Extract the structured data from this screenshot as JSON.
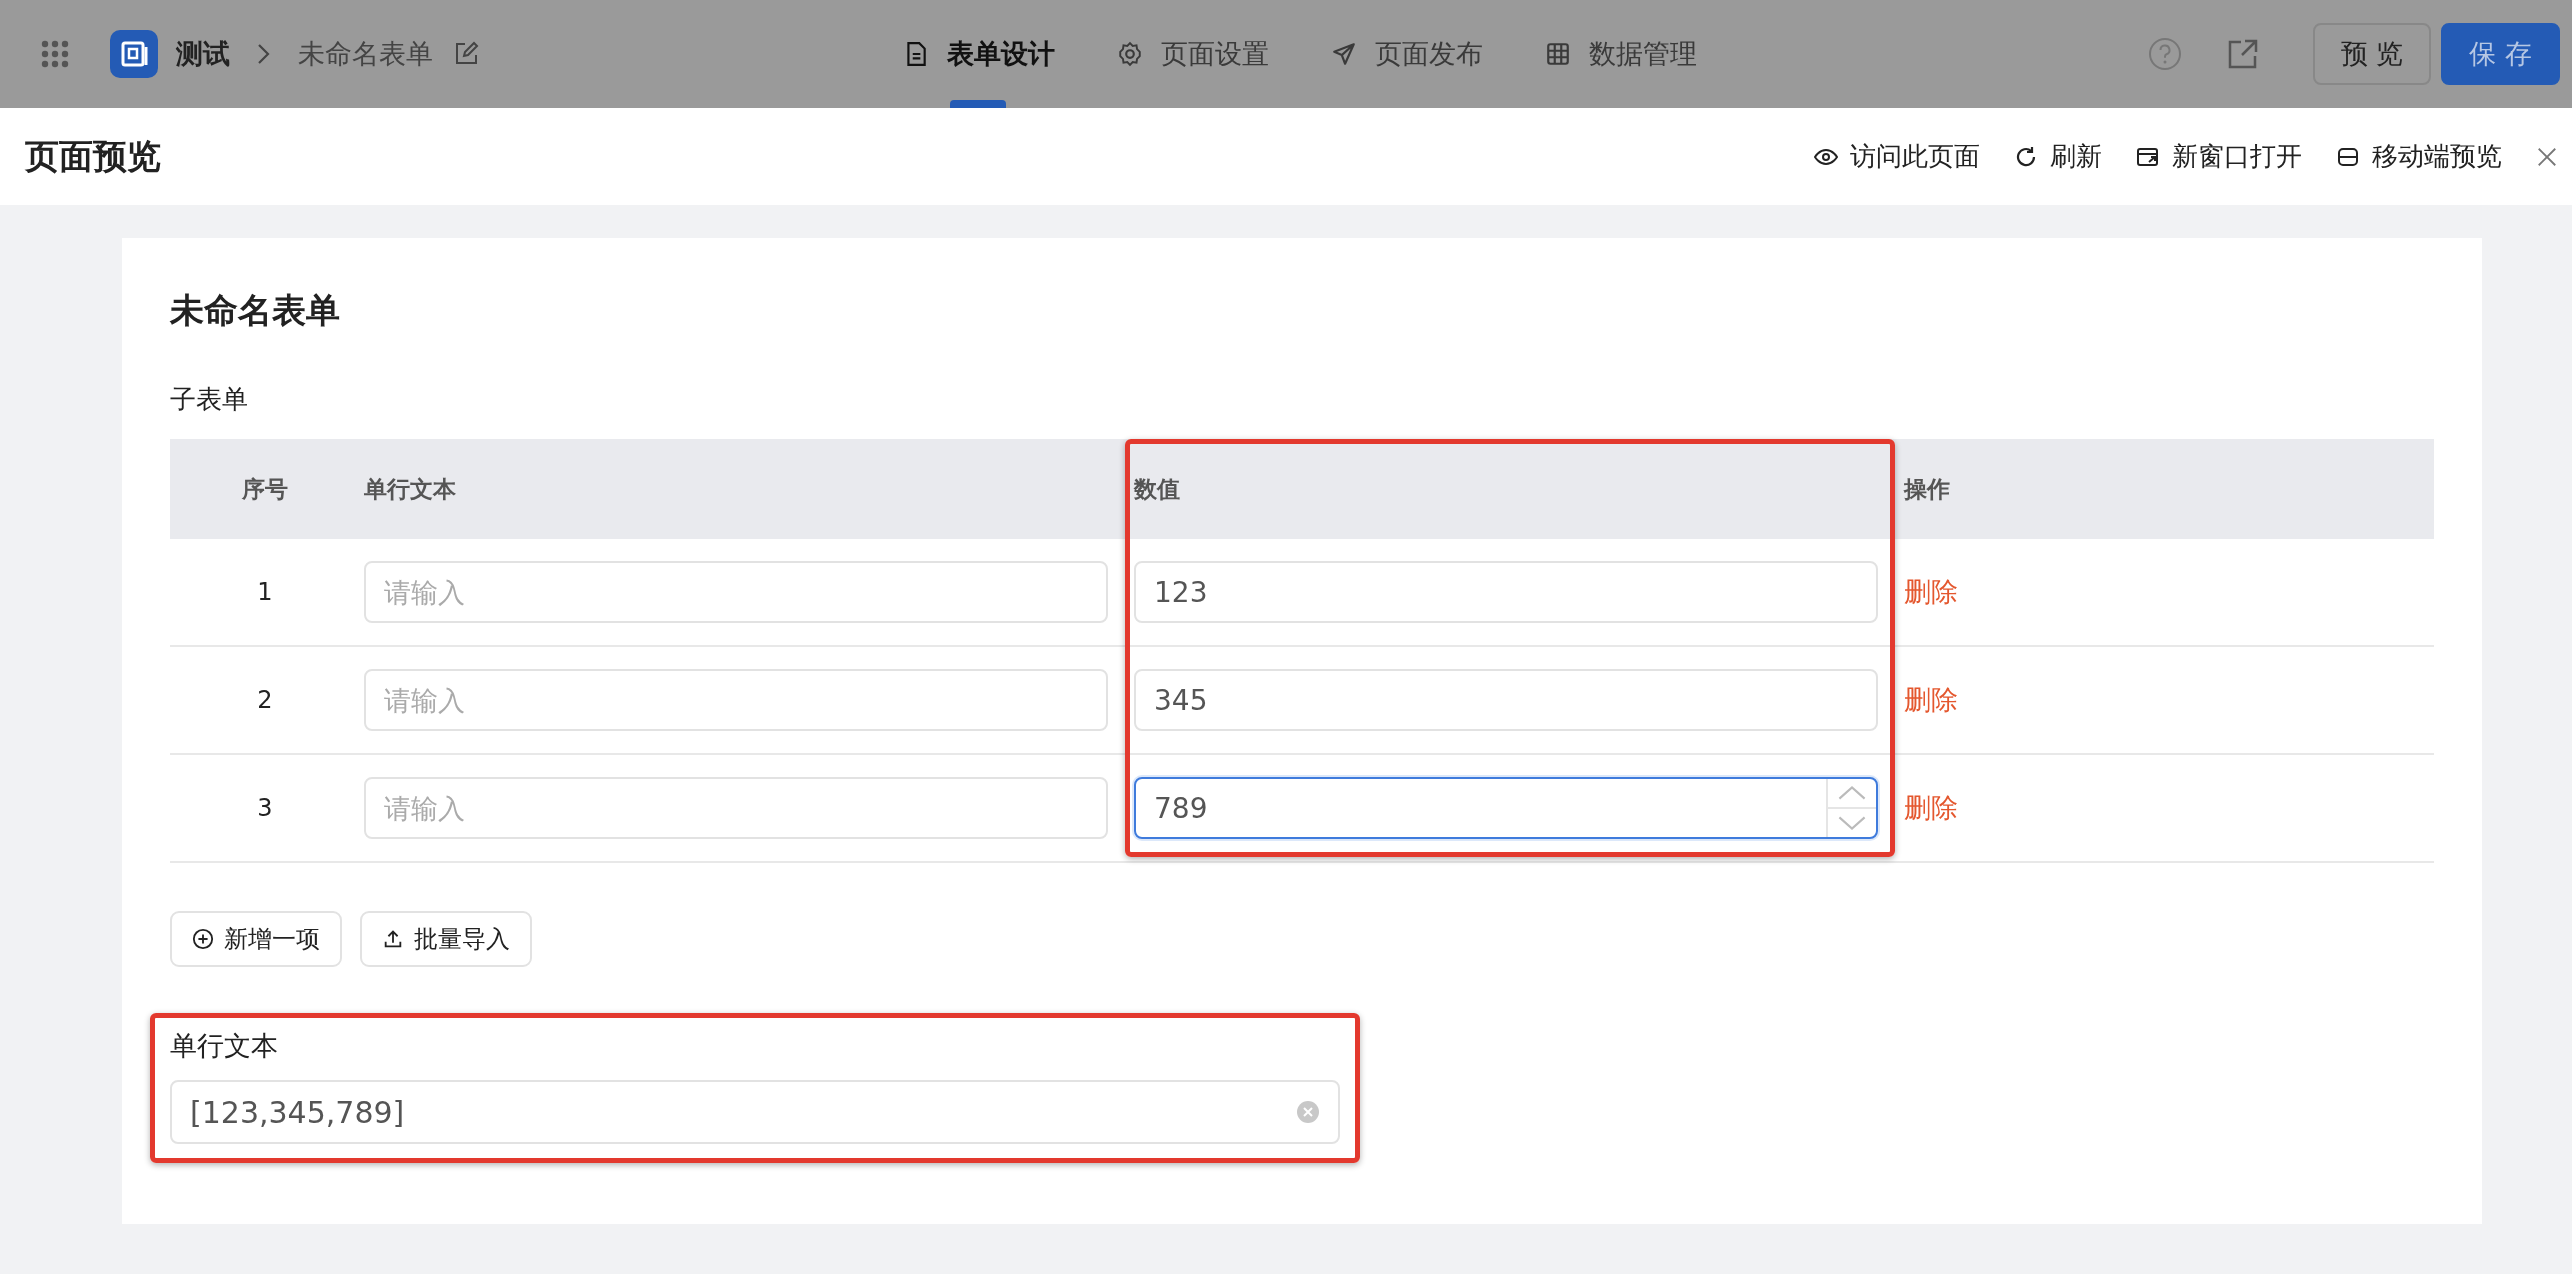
{
  "top_bar": {
    "app_name": "测试",
    "form_name": "未命名表单",
    "tabs": [
      {
        "label": "表单设计",
        "kind": "doc",
        "selected": true
      },
      {
        "label": "页面设置",
        "kind": "gear",
        "selected": false
      },
      {
        "label": "页面发布",
        "kind": "send",
        "selected": false
      },
      {
        "label": "数据管理",
        "kind": "grid",
        "selected": false
      }
    ],
    "buttons": [
      {
        "label": "预 览",
        "kind": "default"
      },
      {
        "label": "保 存",
        "kind": "primary"
      }
    ]
  },
  "preview": {
    "title": "页面预览",
    "actions": [
      {
        "label": "访问此页面",
        "kind": "eye"
      },
      {
        "label": "刷新",
        "kind": "refresh"
      },
      {
        "label": "新窗口打开",
        "kind": "window"
      },
      {
        "label": "移动端预览",
        "kind": "mobile"
      }
    ]
  },
  "form": {
    "title": "未命名表单",
    "subform": {
      "label": "子表单",
      "columns": [
        "序号",
        "单行文本",
        "数值",
        "操作"
      ],
      "rows": [
        {
          "index": "1",
          "text_placeholder": "请输入",
          "number": "123",
          "focused": false,
          "action": "删除"
        },
        {
          "index": "2",
          "text_placeholder": "请输入",
          "number": "345",
          "focused": false,
          "action": "删除"
        },
        {
          "index": "3",
          "text_placeholder": "请输入",
          "number": "789",
          "focused": true,
          "action": "删除"
        }
      ]
    },
    "buttons": [
      {
        "label": "新增一项",
        "kind": "add"
      },
      {
        "label": "批量导入",
        "kind": "import"
      }
    ],
    "text_field": {
      "label": "单行文本",
      "value": "[123,345,789]"
    }
  }
}
